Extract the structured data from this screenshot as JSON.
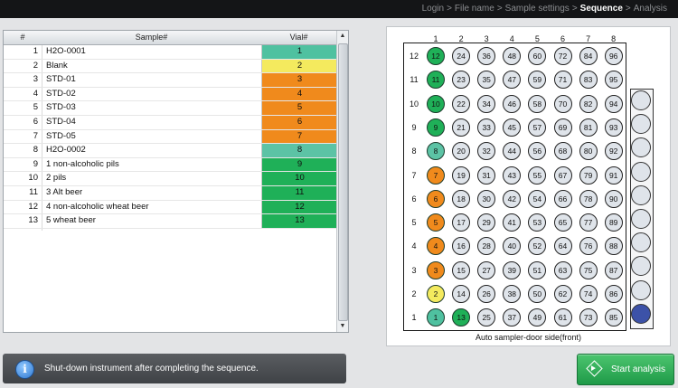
{
  "breadcrumb": {
    "steps": [
      "Login",
      "File name",
      "Sample settings",
      "Sequence",
      "Analysis"
    ],
    "current": "Sequence",
    "separator": ">"
  },
  "table": {
    "headers": {
      "num": "#",
      "sample": "Sample#",
      "vial": "Vial#"
    },
    "rows": [
      {
        "num": "1",
        "sample": "H2O-0001",
        "vial": "1",
        "color": "#4fc1a0"
      },
      {
        "num": "2",
        "sample": "Blank",
        "vial": "2",
        "color": "#f4ea5e"
      },
      {
        "num": "3",
        "sample": "STD-01",
        "vial": "3",
        "color": "#f08a1c"
      },
      {
        "num": "4",
        "sample": "STD-02",
        "vial": "4",
        "color": "#f08a1c"
      },
      {
        "num": "5",
        "sample": "STD-03",
        "vial": "5",
        "color": "#f08a1c"
      },
      {
        "num": "6",
        "sample": "STD-04",
        "vial": "6",
        "color": "#f08a1c"
      },
      {
        "num": "7",
        "sample": "STD-05",
        "vial": "7",
        "color": "#f08a1c"
      },
      {
        "num": "8",
        "sample": "H2O-0002",
        "vial": "8",
        "color": "#5cc3a5"
      },
      {
        "num": "9",
        "sample": "1 non-alcoholic pils",
        "vial": "9",
        "color": "#1fb058"
      },
      {
        "num": "10",
        "sample": "2 pils",
        "vial": "10",
        "color": "#1fb058"
      },
      {
        "num": "11",
        "sample": "3 Alt beer",
        "vial": "11",
        "color": "#1fb058"
      },
      {
        "num": "12",
        "sample": "4 non-alcoholic wheat beer",
        "vial": "12",
        "color": "#1fb058"
      },
      {
        "num": "13",
        "sample": "5 wheat beer",
        "vial": "13",
        "color": "#1fb058"
      }
    ]
  },
  "tray": {
    "columns": [
      "1",
      "2",
      "3",
      "4",
      "5",
      "6",
      "7",
      "8"
    ],
    "rows": [
      "12",
      "11",
      "10",
      "9",
      "8",
      "7",
      "6",
      "5",
      "4",
      "3",
      "2",
      "1"
    ],
    "wells": [
      [
        "12",
        "24",
        "36",
        "48",
        "60",
        "72",
        "84",
        "96"
      ],
      [
        "11",
        "23",
        "35",
        "47",
        "59",
        "71",
        "83",
        "95"
      ],
      [
        "10",
        "22",
        "34",
        "46",
        "58",
        "70",
        "82",
        "94"
      ],
      [
        "9",
        "21",
        "33",
        "45",
        "57",
        "69",
        "81",
        "93"
      ],
      [
        "8",
        "20",
        "32",
        "44",
        "56",
        "68",
        "80",
        "92"
      ],
      [
        "7",
        "19",
        "31",
        "43",
        "55",
        "67",
        "79",
        "91"
      ],
      [
        "6",
        "18",
        "30",
        "42",
        "54",
        "66",
        "78",
        "90"
      ],
      [
        "5",
        "17",
        "29",
        "41",
        "53",
        "65",
        "77",
        "89"
      ],
      [
        "4",
        "16",
        "28",
        "40",
        "52",
        "64",
        "76",
        "88"
      ],
      [
        "3",
        "15",
        "27",
        "39",
        "51",
        "63",
        "75",
        "87"
      ],
      [
        "2",
        "14",
        "26",
        "38",
        "50",
        "62",
        "74",
        "86"
      ],
      [
        "1",
        "13",
        "25",
        "37",
        "49",
        "61",
        "73",
        "85"
      ]
    ],
    "well_colors": {
      "1": "#4fc1a0",
      "2": "#f4ea5e",
      "3": "#f08a1c",
      "4": "#f08a1c",
      "5": "#f08a1c",
      "6": "#f08a1c",
      "7": "#f08a1c",
      "8": "#5cc3a5",
      "9": "#1fb058",
      "10": "#1fb058",
      "11": "#1fb058",
      "12": "#1fb058",
      "13": "#1fb058"
    },
    "external_positions": [
      {
        "color": "#dfe4ea"
      },
      {
        "color": "#dfe4ea"
      },
      {
        "color": "#dfe4ea"
      },
      {
        "color": "#dfe4ea"
      },
      {
        "color": "#dfe4ea"
      },
      {
        "color": "#dfe4ea"
      },
      {
        "color": "#dfe4ea"
      },
      {
        "color": "#dfe4ea"
      },
      {
        "color": "#dfe4ea"
      },
      {
        "color": "#3c52a8"
      }
    ],
    "caption": "Auto sampler-door side(front)"
  },
  "info": {
    "icon": "info-icon",
    "message": "Shut-down instrument after completing the sequence."
  },
  "start_button": {
    "label": "Start analysis",
    "icon": "start-diamond-icon",
    "color": "#2aa854"
  }
}
